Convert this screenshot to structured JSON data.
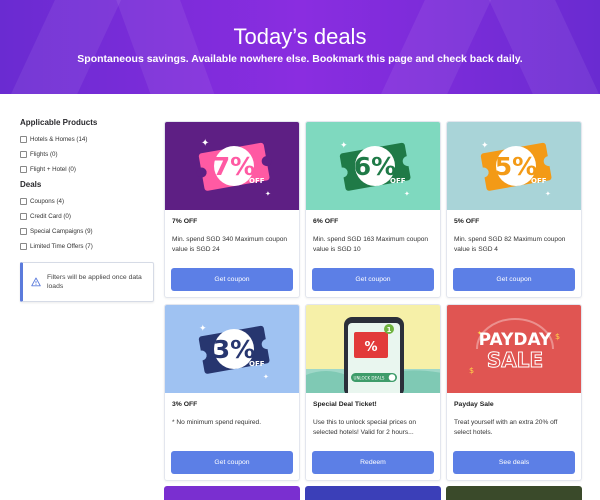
{
  "hero": {
    "title": "Today’s deals",
    "subtitle": "Spontaneous savings. Available nowhere else. Bookmark this page and check back daily."
  },
  "sidebar": {
    "products_heading": "Applicable Products",
    "products": [
      {
        "label": "Hotels & Homes (14)"
      },
      {
        "label": "Flights (0)"
      },
      {
        "label": "Flight + Hotel (0)"
      }
    ],
    "deals_heading": "Deals",
    "deals": [
      {
        "label": "Coupons (4)"
      },
      {
        "label": "Credit Card (0)"
      },
      {
        "label": "Special Campaigns (9)"
      },
      {
        "label": "Limited Time Offers (7)"
      }
    ],
    "notice": "Filters will be applied once data loads"
  },
  "cards": [
    {
      "badge_value": "7%",
      "badge_off": "OFF",
      "title": "7% OFF",
      "desc": "Min. spend SGD 340 Maximum coupon value is SGD 24",
      "button": "Get coupon",
      "bg": "#5e1f84",
      "ticket": "#ff5aa3"
    },
    {
      "badge_value": "6%",
      "badge_off": "OFF",
      "title": "6% OFF",
      "desc": "Min. spend SGD 163 Maximum coupon value is SGD 10",
      "button": "Get coupon",
      "bg": "#7fd9bf",
      "ticket": "#1f7a47"
    },
    {
      "badge_value": "5%",
      "badge_off": "OFF",
      "title": "5% OFF",
      "desc": "Min. spend SGD 82 Maximum coupon value is SGD 4",
      "button": "Get coupon",
      "bg": "#a9d4d8",
      "ticket": "#f39a16"
    },
    {
      "badge_value": "3%",
      "badge_off": "OFF",
      "title": "3% OFF",
      "desc": "* No minimum spend required.",
      "button": "Get coupon",
      "bg": "#9fc2f2",
      "ticket": "#27366f"
    },
    {
      "badge_value": "%",
      "phone_caption": "UNLOCK DEALS",
      "notif": "1",
      "title": "Special Deal Ticket!",
      "desc": "Use this to unlock special prices on selected hotels! Valid for 2 hours...",
      "button": "Redeem"
    },
    {
      "banner_top": "PAYDAY",
      "banner_bottom": "SALE",
      "title": "Payday Sale",
      "desc": "Treat yourself with an extra 20% off select hotels.",
      "button": "See deals",
      "bg": "#e05552"
    }
  ]
}
